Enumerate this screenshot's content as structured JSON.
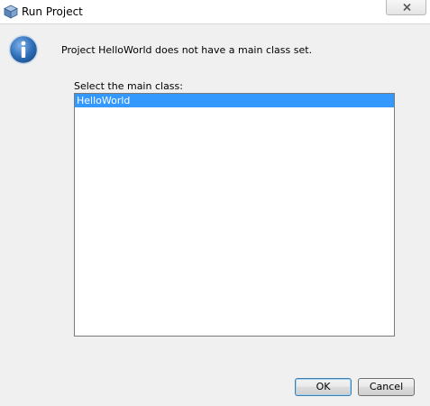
{
  "window": {
    "title": "Run Project",
    "icon": "netbeans-cube-icon"
  },
  "dialog": {
    "message": "Project HelloWorld does not have a main class set.",
    "select_label": "Select the main class:",
    "classes": [
      {
        "label": "HelloWorld",
        "selected": true
      }
    ],
    "ok_label": "OK",
    "cancel_label": "Cancel"
  },
  "colors": {
    "selection": "#3399ff",
    "info_icon": "#2f6fb8"
  }
}
